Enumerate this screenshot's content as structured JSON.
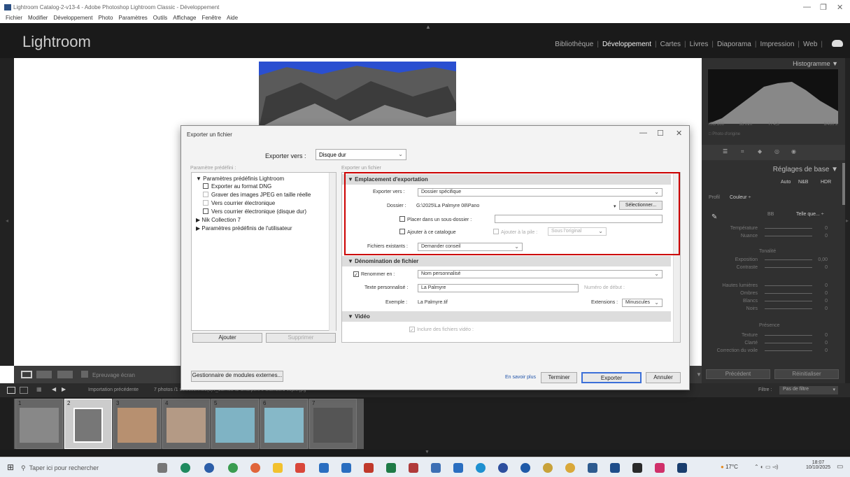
{
  "window": {
    "title": "Lightroom Catalog-2-v13-4 - Adobe Photoshop Lightroom Classic - Développement"
  },
  "menu": [
    "Fichier",
    "Modifier",
    "Développement",
    "Photo",
    "Paramètres",
    "Outils",
    "Affichage",
    "Fenêtre",
    "Aide"
  ],
  "lr": {
    "logo": "Lightroom",
    "modules": [
      "Bibliothèque",
      "Développement",
      "Cartes",
      "Livres",
      "Diaporama",
      "Impression",
      "Web"
    ],
    "active_module": "Développement"
  },
  "right_panel": {
    "histogram": "Histogramme",
    "iso": "ISO 800",
    "focal": "35 mm",
    "aperture": "f / 4,5",
    "shutter": "1/400 s",
    "original": "Photo d'origine",
    "basic": "Réglages de base",
    "modes": [
      "Auto",
      "N&B",
      "HDR"
    ],
    "profile_label": "Profil",
    "profile_value": "Couleur",
    "wb_label": "BB",
    "wb_value": "Telle que...",
    "temp": "Température",
    "tint": "Nuance",
    "tone": "Tonalité",
    "exposure": "Exposition",
    "exposure_val": "0,00",
    "contrast": "Contraste",
    "highlights": "Hautes lumières",
    "shadows": "Ombres",
    "whites": "Blancs",
    "blacks": "Noirs",
    "presence": "Présence",
    "texture": "Texture",
    "clarity": "Clarté",
    "dehaze": "Correction du voile",
    "zero": "0",
    "prev": "Précédent",
    "reset": "Réinitialiser"
  },
  "toolbar": {
    "softproof": "Epreuvage écran"
  },
  "filmstrip": {
    "source": "Importation précédente",
    "count": "7 photos /1 sélectionnée(s) /_9DR3542-SharpenAI-Standard copie.jpg",
    "filter_label": "Filtre :",
    "filter_value": "Pas de filtre",
    "numbers": [
      "1",
      "2",
      "3",
      "4",
      "5",
      "6",
      "7"
    ]
  },
  "dialog": {
    "title": "Exporter un fichier",
    "export_to_label": "Exporter vers :",
    "export_to_value": "Disque dur",
    "presets_label": "Paramètre prédéfini :",
    "presets": [
      "Paramètres prédéfinis Lightroom",
      "Exporter au format DNG",
      "Graver des images JPEG en taille réelle",
      "Vers courrier électronique",
      "Vers courrier électronique (disque dur)",
      "Nik Collection 7",
      "Paramètres prédéfinis de l'utilisateur"
    ],
    "add": "Ajouter",
    "remove": "Supprimer",
    "export_file_label": "Exporter un fichier",
    "loc": {
      "header": "Emplacement d'exportation",
      "export_to_label": "Exporter vers :",
      "export_to_value": "Dossier spécifique",
      "folder_label": "Dossier :",
      "folder_value": "G:\\2025\\La Palmyre 08\\Pano",
      "select_btn": "Sélectionner...",
      "subfolder": "Placer dans un sous-dossier :",
      "add_catalog": "Ajouter à ce catalogue",
      "add_stack": "Ajouter à la pile :",
      "stack_value": "Sous l'original",
      "existing_label": "Fichiers existants :",
      "existing_value": "Demander conseil"
    },
    "naming": {
      "header": "Dénomination de fichier",
      "rename_label": "Renommer en :",
      "rename_value": "Nom personnalisé",
      "custom_label": "Texte personnalisé :",
      "custom_value": "La Palmyre",
      "start_label": "Numéro de début :",
      "example_label": "Exemple :",
      "example_value": "La Palmyre.tif",
      "ext_label": "Extensions :",
      "ext_value": "Minuscules"
    },
    "video": {
      "header": "Vidéo",
      "include": "Inclure des fichiers vidéo :"
    },
    "plugin_mgr": "Gestionnaire de modules externes...",
    "learn_more": "En savoir plus",
    "done": "Terminer",
    "export": "Exporter",
    "cancel": "Annuler"
  },
  "taskbar": {
    "search": "Taper ici pour rechercher",
    "temp": "17°C",
    "time": "18:07",
    "date": "10/10/2025"
  }
}
